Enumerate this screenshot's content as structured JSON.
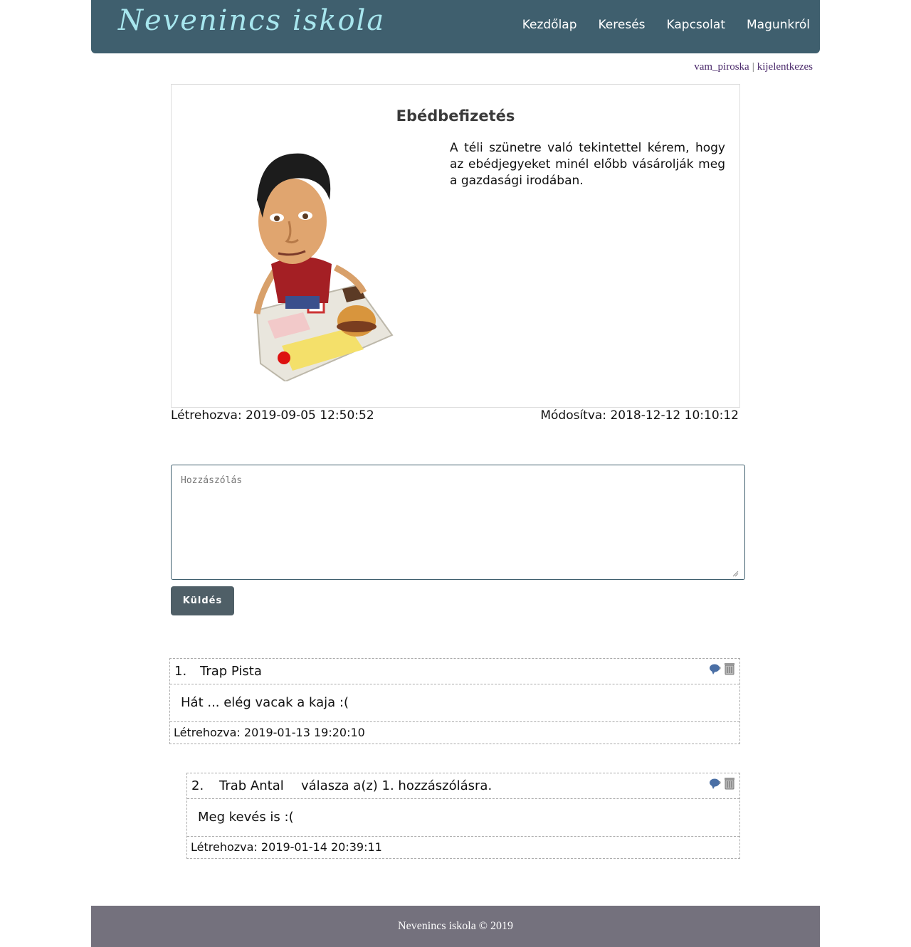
{
  "header": {
    "logo": "Nevenincs iskola",
    "nav": [
      "Kezdőlap",
      "Keresés",
      "Kapcsolat",
      "Magunkról"
    ]
  },
  "userbar": {
    "username": "vam_piroska",
    "separator": "|",
    "logout": "kijelentkezes"
  },
  "article": {
    "title": "Ebédbefizetés",
    "text": "A téli szünetre való tekintettel kérem, hogy az ebédjegyeket minél előbb vásárolják meg a gazdasági irodában.",
    "created": "Létrehozva: 2019-09-05 12:50:52",
    "modified": "Módosítva: 2018-12-12 10:10:12"
  },
  "comment_form": {
    "placeholder": "Hozzászólás",
    "submit_label": "Küldés"
  },
  "comments": [
    {
      "number": "1.",
      "author": "Trap Pista",
      "reply_text": "",
      "body": "Hát ... elég vacak a kaja :(",
      "created": "Létrehozva: 2019-01-13 19:20:10"
    },
    {
      "number": "2.",
      "author": "Trab Antal",
      "reply_text": "válasza a(z) 1. hozzászólásra.",
      "body": "Meg kevés is :(",
      "created": "Létrehozva: 2019-01-14 20:39:11"
    }
  ],
  "icons": {
    "reply": "speech-bubble-icon",
    "delete": "trash-icon"
  },
  "footer": {
    "text": "Nevenincs iskola © 2019"
  },
  "colors": {
    "header": "#3f5f6e",
    "logo": "#a7e6ee",
    "button": "#4f5f67",
    "footer": "#74717d"
  }
}
